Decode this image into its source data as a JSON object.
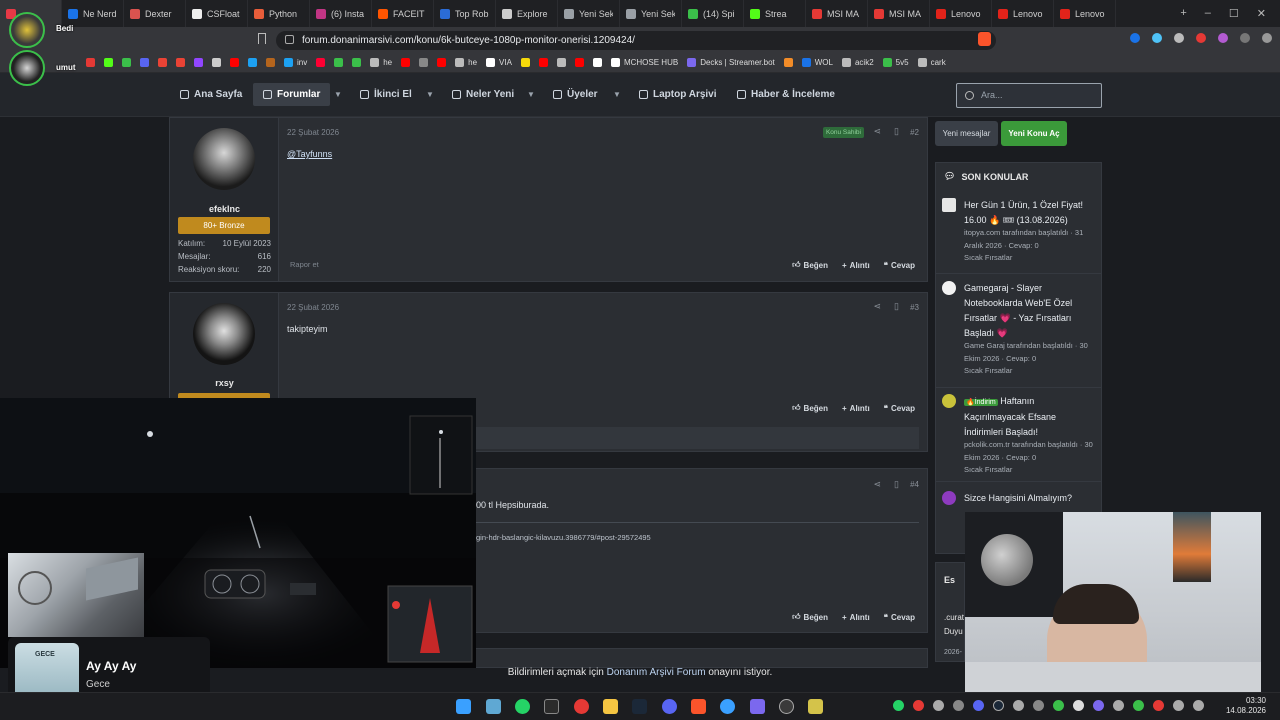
{
  "browser": {
    "tabs": [
      {
        "label": "",
        "color": "#e63946"
      },
      {
        "label": "Ne Nerd",
        "color": "#1a73e8"
      },
      {
        "label": "Dexter",
        "color": "#d9534f"
      },
      {
        "label": "CSFloat",
        "color": "#eeeeee"
      },
      {
        "label": "Python",
        "color": "#e85d3a"
      },
      {
        "label": "(6) Insta",
        "color": "#c13584"
      },
      {
        "label": "FACEIT",
        "color": "#ff5500"
      },
      {
        "label": "Top Rob",
        "color": "#2b6cd6"
      },
      {
        "label": "Explore",
        "color": "#cccccc"
      },
      {
        "label": "Yeni Sek",
        "color": "#9aa0a6"
      },
      {
        "label": "Yeni Sek",
        "color": "#9aa0a6"
      },
      {
        "label": "(14) Spi",
        "color": "#3bbf4a"
      },
      {
        "label": "Strea",
        "color": "#53fc18"
      },
      {
        "label": "MSI MA",
        "color": "#e53935"
      },
      {
        "label": "MSI MA",
        "color": "#e53935"
      },
      {
        "label": "Lenovo",
        "color": "#e2231a"
      },
      {
        "label": "Lenovo",
        "color": "#e2231a"
      },
      {
        "label": "Lenovo",
        "color": "#e2231a"
      }
    ],
    "url": "forum.donanimarsivi.com/konu/6k-butceye-1080p-monitor-onerisi.1209424/",
    "bookmarks": [
      {
        "label": "",
        "color": "#e53935"
      },
      {
        "label": "",
        "color": "#53fc18"
      },
      {
        "label": "",
        "color": "#3bbf4a"
      },
      {
        "label": "",
        "color": "#5865f2"
      },
      {
        "label": "",
        "color": "#ea4335"
      },
      {
        "label": "",
        "color": "#ea4335"
      },
      {
        "label": "",
        "color": "#9146ff"
      },
      {
        "label": "",
        "color": "#cccccc"
      },
      {
        "label": "",
        "color": "#ff0000"
      },
      {
        "label": "",
        "color": "#1da1f2"
      },
      {
        "label": "",
        "color": "#b5651d"
      },
      {
        "label": "inv",
        "color": "#1da1f2"
      },
      {
        "label": "",
        "color": "#ff0033"
      },
      {
        "label": "",
        "color": "#3bbf4a"
      },
      {
        "label": "",
        "color": "#3bbf4a"
      },
      {
        "label": "he",
        "color": "#bbbbbb"
      },
      {
        "label": "",
        "color": "#ff0000"
      },
      {
        "label": "",
        "color": "#888888"
      },
      {
        "label": "",
        "color": "#ff0000"
      },
      {
        "label": "he",
        "color": "#bbbbbb"
      },
      {
        "label": "VIA",
        "color": "#ffffff"
      },
      {
        "label": "",
        "color": "#f5d90a"
      },
      {
        "label": "",
        "color": "#ff0000"
      },
      {
        "label": "",
        "color": "#bbbbbb"
      },
      {
        "label": "",
        "color": "#ff0000"
      },
      {
        "label": "",
        "color": "#ffffff"
      },
      {
        "label": "MCHOSE HUB",
        "color": "#ffffff"
      },
      {
        "label": "Decks | Streamer.bot",
        "color": "#7b68ee"
      },
      {
        "label": "",
        "color": "#f28c28"
      },
      {
        "label": "WOL",
        "color": "#1a73e8"
      },
      {
        "label": "acik2",
        "color": "#bbbbbb"
      },
      {
        "label": "5v5",
        "color": "#3bbf4a"
      },
      {
        "label": "cark",
        "color": "#bbbbbb"
      }
    ]
  },
  "nav": {
    "items": [
      {
        "label": "Ana Sayfa"
      },
      {
        "label": "Forumlar"
      },
      {
        "label": "İkinci El"
      },
      {
        "label": "Neler Yeni"
      },
      {
        "label": "Üyeler"
      },
      {
        "label": "Laptop Arşivi"
      },
      {
        "label": "Haber & İnceleme"
      }
    ],
    "search_placeholder": "Ara..."
  },
  "posts": [
    {
      "date": "22 Şubat 2026",
      "number": "#2",
      "owner_badge": "Konu Sahibi",
      "username": "efekInc",
      "rank": "80+ Bronze",
      "stats": [
        {
          "label": "Katılım:",
          "value": "10 Eylül 2023"
        },
        {
          "label": "Mesajlar:",
          "value": "616"
        },
        {
          "label": "Reaksiyon skoru:",
          "value": "220"
        }
      ],
      "body": "@Tayfunns",
      "report": "Rapor et"
    },
    {
      "date": "22 Şubat 2026",
      "number": "#3",
      "username": "rxsy",
      "body": "takipteyim"
    },
    {
      "number": "#4",
      "body_fragment": "00 tl Hepsiburada.",
      "link_fragment": "gin-hdr-baslangic-kilavuzu.3986779/#post-29572495"
    }
  ],
  "actions": {
    "like": "Beğen",
    "quote": "Alıntı",
    "reply": "Cevap"
  },
  "sidebar": {
    "btn_new_messages": "Yeni mesajlar",
    "btn_new_thread": "Yeni Konu Aç",
    "son_konular_title": "SON KONULAR",
    "topics": [
      {
        "title": "Her Gün 1 Ürün, 1 Özel Fiyat! 16.00 🔥 🎟 (13.08.2026)",
        "meta": "itopya.com tarafından başlatıldı · 31 Aralık 2026 · Cevap: 0",
        "forum": "Sıcak Fırsatlar",
        "icon_color": "#e6e6e6"
      },
      {
        "title": "Gamegaraj - Slayer Notebooklarda Web'E Özel Fırsatlar 💗 - Yaz Fırsatları Başladı 💗",
        "meta": "Game Garaj tarafından başlatıldı · 30 Ekim 2026 · Cevap: 0",
        "forum": "Sıcak Fırsatlar",
        "icon_color": "#f2f2f2"
      },
      {
        "tag": "🔥İndirim",
        "title": "Haftanın Kaçırılmayacak Efsane İndirimleri Başladı!",
        "meta": "pckolik.com.tr tarafından başlatıldı · 30 Ekim 2026 · Cevap: 0",
        "forum": "Sıcak Fırsatlar",
        "icon_color": "#c9c23a"
      },
      {
        "title": "Sizce Hangisini Almalıyım?",
        "icon_color": "#8e3bbf"
      }
    ],
    "next_section_fragment": "Es",
    "next_item_fragment": ".curat",
    "next_item_fragment2": "Duyu",
    "next_item_date": "2026-"
  },
  "stream": {
    "user1": "Bedi",
    "user2": "umut",
    "now_playing_title": "Ay Ay Ay",
    "now_playing_artist": "Gece",
    "album_art_text": "GECE"
  },
  "notification": {
    "prefix": "Bildirimleri açmak için",
    "link": "Donanım Arşivi Forum",
    "suffix": "onayını istiyor."
  },
  "taskbar": {
    "time": "03:30",
    "date": "14.08.2026"
  }
}
